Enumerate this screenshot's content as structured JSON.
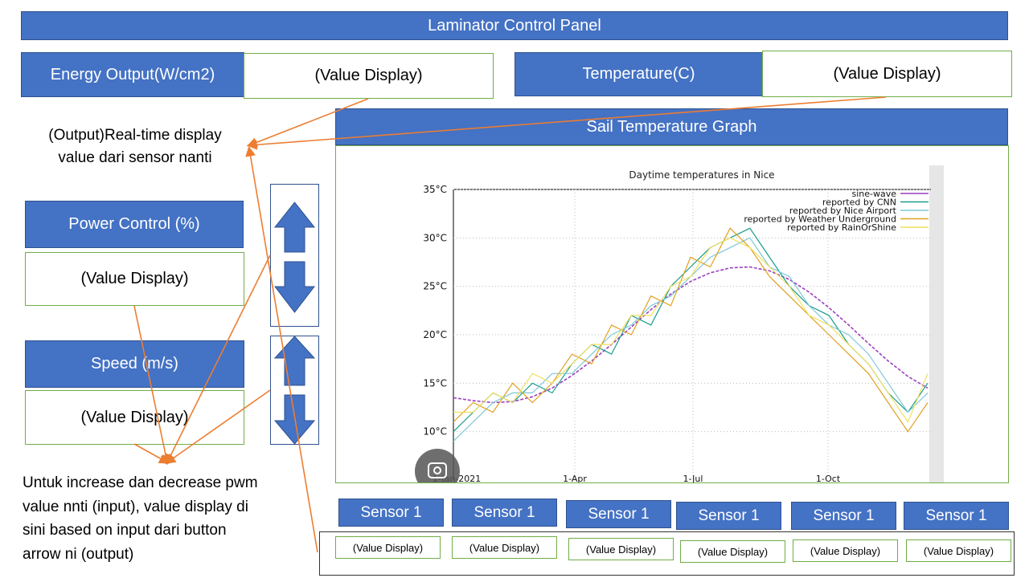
{
  "title": "Laminator Control Panel",
  "energy": {
    "label": "Energy Output(W/cm2)",
    "value": "(Value Display)"
  },
  "temperature": {
    "label": "Temperature(C)",
    "value": "(Value Display)"
  },
  "output_note": {
    "line1": "(Output)Real-time display",
    "line2": "value dari sensor nanti"
  },
  "graph_header": "Sail Temperature Graph",
  "power": {
    "label": "Power Control (%)",
    "value": "(Value Display)"
  },
  "speed": {
    "label": "Speed (m/s)",
    "value": "(Value Display)"
  },
  "input_note": {
    "line1": "Untuk increase dan decrease pwm",
    "line2": "value nnti (input), value display di",
    "line3": "sini based on input dari button",
    "line4": "arrow ni (output)"
  },
  "sensors": [
    {
      "label": "Sensor 1",
      "value": "(Value Display)"
    },
    {
      "label": "Sensor 1",
      "value": "(Value Display)"
    },
    {
      "label": "Sensor 1",
      "value": "(Value Display)"
    },
    {
      "label": "Sensor 1",
      "value": "(Value Display)"
    },
    {
      "label": "Sensor 1",
      "value": "(Value Display)"
    },
    {
      "label": "Sensor 1",
      "value": "(Value Display)"
    }
  ],
  "colors": {
    "header_blue": "#4472C4",
    "border_green": "#70AD47",
    "connector_orange": "#ED7D31"
  },
  "chart_data": {
    "type": "line",
    "title": "Daytime temperatures in Nice",
    "y_ticks": [
      "35°C",
      "30°C",
      "25°C",
      "20°C",
      "15°C",
      "10°C"
    ],
    "ylim": [
      5,
      35
    ],
    "x_ticks": [
      "1-Jan-2021",
      "1-Apr",
      "1-Jul",
      "1-Oct"
    ],
    "legend_position": "top-right",
    "grid": true,
    "series": [
      {
        "name": "sine-wave",
        "color": "#9b3fbf",
        "values": [
          13.5,
          13.2,
          13.0,
          13.1,
          13.6,
          14.5,
          15.8,
          17.3,
          19.0,
          20.8,
          22.6,
          24.2,
          25.5,
          26.4,
          26.9,
          27.0,
          26.6,
          25.7,
          24.4,
          22.8,
          21.0,
          19.1,
          17.3,
          15.7,
          14.5
        ]
      },
      {
        "name": "reported by CNN",
        "color": "#1a9c8c",
        "values": [
          10,
          12,
          14,
          13,
          15,
          14,
          17,
          19,
          18,
          22,
          21,
          25,
          27,
          29,
          30,
          31,
          28,
          25,
          23,
          22,
          19,
          17,
          14,
          12,
          15
        ]
      },
      {
        "name": "reported by Nice Airport",
        "color": "#7ec8d6",
        "values": [
          9,
          11,
          13,
          14,
          14,
          16,
          16,
          18,
          20,
          21,
          23,
          24,
          26,
          28,
          29,
          30,
          27,
          26,
          23,
          21,
          20,
          18,
          15,
          12,
          14
        ]
      },
      {
        "name": "reported by Weather Underground",
        "color": "#e0a020",
        "values": [
          11,
          13,
          12,
          15,
          13,
          15,
          18,
          17,
          21,
          20,
          24,
          23,
          28,
          27,
          31,
          29,
          26,
          24,
          22,
          20,
          18,
          16,
          13,
          10,
          13
        ]
      },
      {
        "name": "reported by RainOrShine",
        "color": "#f0e060",
        "values": [
          12,
          12,
          14,
          13,
          16,
          15,
          17,
          19,
          19,
          22,
          22,
          25,
          26,
          29,
          30,
          29,
          27,
          25,
          22,
          21,
          19,
          17,
          14,
          11,
          16
        ]
      }
    ]
  }
}
